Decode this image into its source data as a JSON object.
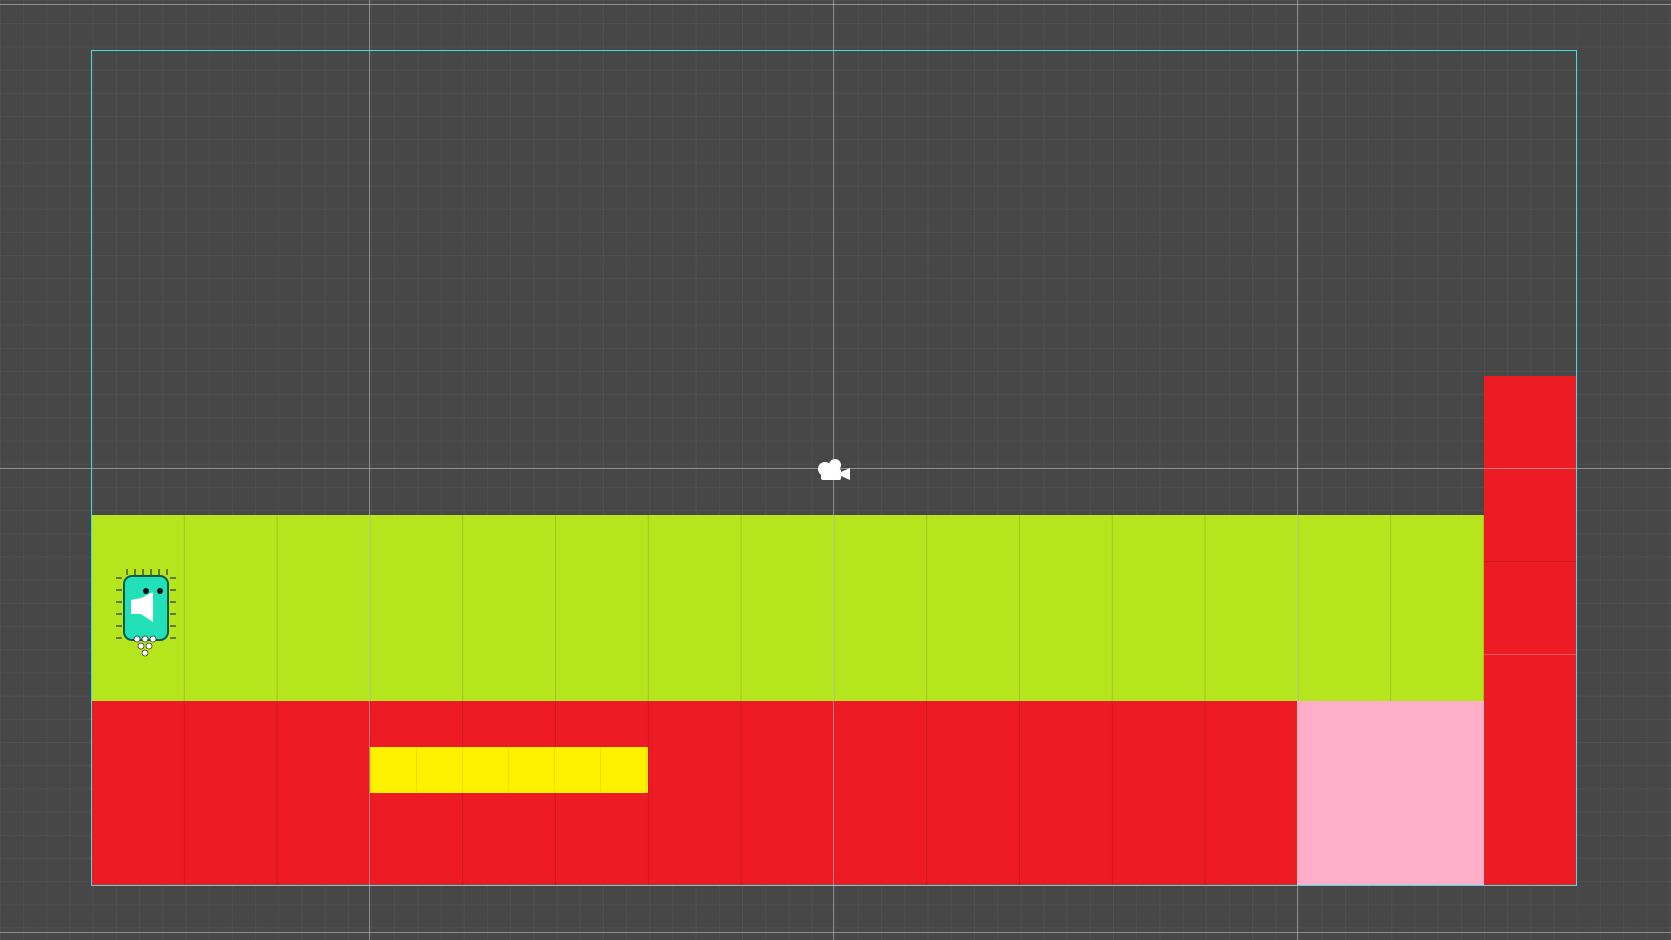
{
  "scene": {
    "background_color": "#474747",
    "camera_bounds_color": "#3ee0e6"
  },
  "tiles": {
    "ground_color": "#b5e61d",
    "hazard_color": "#ed1c24",
    "platform_color": "#fff200",
    "goal_zone_color": "#ffaec9"
  },
  "player": {
    "icon": "player-sprite-icon",
    "color": "#22e0b8"
  },
  "camera": {
    "icon": "camera-icon"
  }
}
